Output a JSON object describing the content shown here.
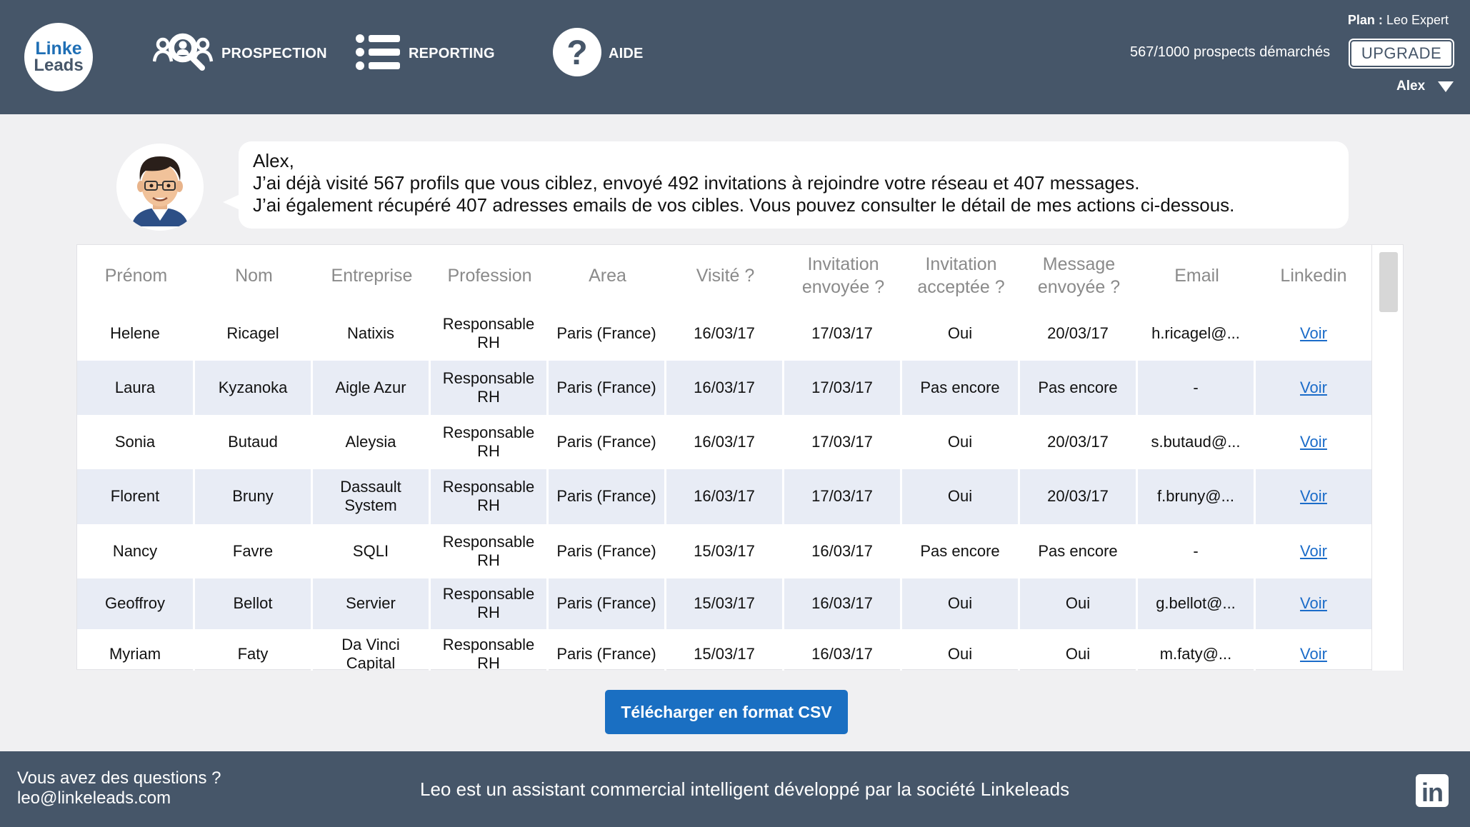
{
  "logo": {
    "line1": "Linke",
    "line2": "Leads"
  },
  "nav": {
    "prospection": "PROSPECTION",
    "reporting": "REPORTING",
    "aide": "AIDE"
  },
  "plan": {
    "label": "Plan :",
    "value": "Leo Expert"
  },
  "prospects_count": "567/1000 prospects démarchés",
  "upgrade_label": "UPGRADE",
  "user_name": "Alex",
  "message": {
    "greeting": "Alex,",
    "line1": "J’ai déjà visité 567 profils que vous ciblez, envoyé 492 invitations à rejoindre votre réseau et 407 messages.",
    "line2": "J’ai également récupéré 407 adresses emails de vos cibles. Vous pouvez consulter le détail de mes actions ci-dessous."
  },
  "table": {
    "headers": [
      "Prénom",
      "Nom",
      "Entreprise",
      "Profession",
      "Area",
      "Visité ?",
      "Invitation envoyée ?",
      "Invitation acceptée ?",
      "Message envoyée ?",
      "Email",
      "Linkedin"
    ],
    "rows": [
      [
        "Helene",
        "Ricagel",
        "Natixis",
        "Responsable RH",
        "Paris (France)",
        "16/03/17",
        "17/03/17",
        "Oui",
        "20/03/17",
        "h.ricagel@...",
        "Voir"
      ],
      [
        "Laura",
        "Kyzanoka",
        "Aigle Azur",
        "Responsable RH",
        "Paris (France)",
        "16/03/17",
        "17/03/17",
        "Pas encore",
        "Pas encore",
        "-",
        "Voir"
      ],
      [
        "Sonia",
        "Butaud",
        "Aleysia",
        "Responsable RH",
        "Paris (France)",
        "16/03/17",
        "17/03/17",
        "Oui",
        "20/03/17",
        "s.butaud@...",
        "Voir"
      ],
      [
        "Florent",
        "Bruny",
        "Dassault System",
        "Responsable RH",
        "Paris (France)",
        "16/03/17",
        "17/03/17",
        "Oui",
        "20/03/17",
        "f.bruny@...",
        "Voir"
      ],
      [
        "Nancy",
        "Favre",
        "SQLI",
        "Responsable RH",
        "Paris (France)",
        "15/03/17",
        "16/03/17",
        "Pas encore",
        "Pas encore",
        "-",
        "Voir"
      ],
      [
        "Geoffroy",
        "Bellot",
        "Servier",
        "Responsable RH",
        "Paris (France)",
        "15/03/17",
        "16/03/17",
        "Oui",
        "Oui",
        "g.bellot@...",
        "Voir"
      ],
      [
        "Myriam",
        "Faty",
        "Da Vinci Capital",
        "Responsable RH",
        "Paris (France)",
        "15/03/17",
        "16/03/17",
        "Oui",
        "Oui",
        "m.faty@...",
        "Voir"
      ]
    ]
  },
  "csv_button": "Télécharger en format CSV",
  "footer": {
    "question": "Vous avez des questions ?",
    "email": "leo@linkeleads.com",
    "tagline": "Leo est un assistant commercial intelligent développé par la société Linkeleads",
    "linkedin_icon_text": "in"
  },
  "colors": {
    "header_bg": "#465669",
    "accent": "#1a6fc2",
    "row_alt": "#e8ecf5",
    "link": "#1b6cc9"
  },
  "icons": {
    "prospection": "people-search-icon",
    "reporting": "list-icon",
    "aide": "question-icon",
    "linkedin": "linkedin-icon"
  }
}
